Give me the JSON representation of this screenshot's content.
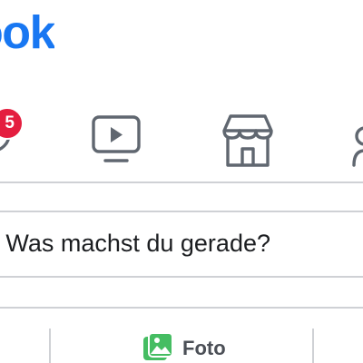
{
  "header": {
    "logo_text": "facebook",
    "brand_color": "#1877f2"
  },
  "nav": {
    "items": [
      {
        "name": "friends",
        "icon": "friends-icon",
        "badge": "5"
      },
      {
        "name": "watch",
        "icon": "video-play-icon"
      },
      {
        "name": "marketplace",
        "icon": "marketplace-store-icon"
      },
      {
        "name": "groups",
        "icon": "groups-icon"
      }
    ],
    "badge_color": "#e41e3f",
    "icon_color": "#606770"
  },
  "composer": {
    "placeholder": "Was machst du gerade?"
  },
  "actions": {
    "photo_label": "Foto",
    "photo_icon": "photo-icon",
    "photo_icon_color": "#45bd62"
  },
  "divider_color": "#cfd1d5"
}
